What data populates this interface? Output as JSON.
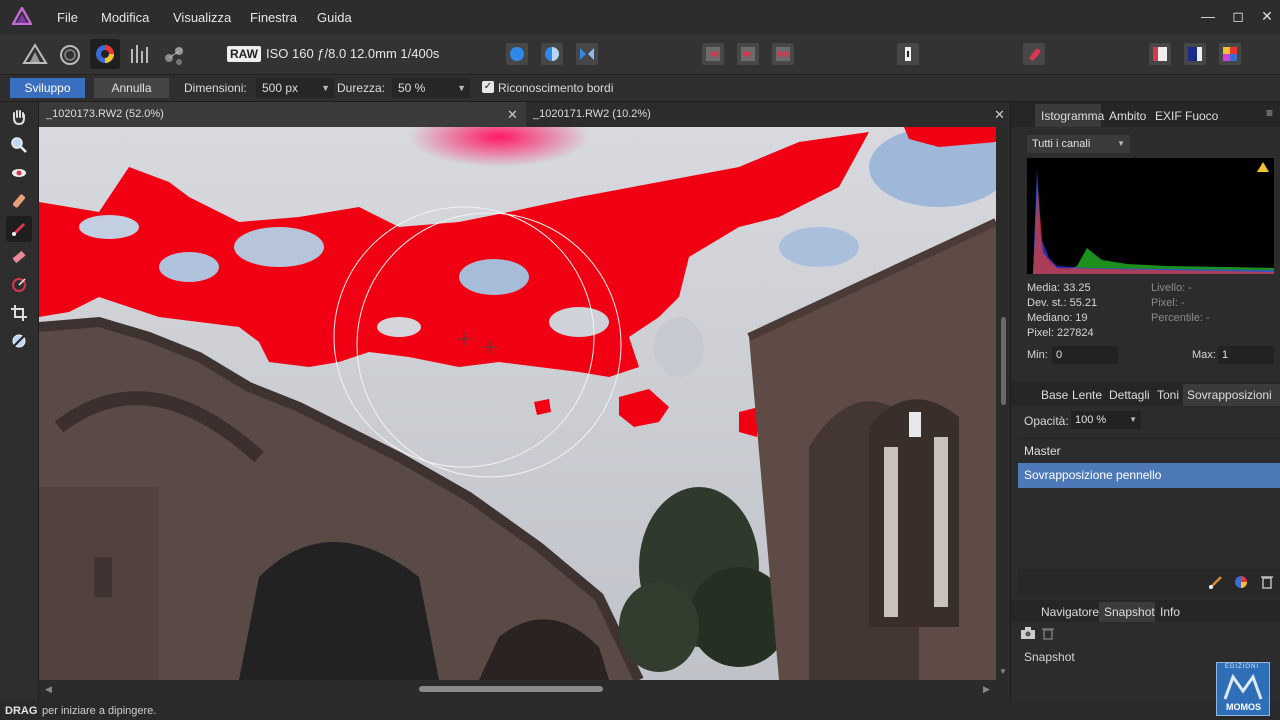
{
  "menubar": {
    "items": [
      "File",
      "Modifica",
      "Visualizza",
      "Finestra",
      "Guida"
    ]
  },
  "toolbar": {
    "raw_badge": "RAW",
    "exif_summary": "ISO 160 ƒ/8.0 12.0mm 1/400s"
  },
  "context": {
    "develop_button": "Sviluppo",
    "cancel_button": "Annulla",
    "size_label": "Dimensioni:",
    "size_value": "500 px",
    "hardness_label": "Durezza:",
    "hardness_value": "50 %",
    "edge_detection_label": "Riconoscimento bordi",
    "edge_detection_checked": true
  },
  "tabs": [
    {
      "label": "_1020173.RW2 (52.0%)"
    },
    {
      "label": "_1020171.RW2 (10.2%)"
    }
  ],
  "status": {
    "key": "DRAG",
    "hint": "per iniziare a dipingere."
  },
  "histogram_panel": {
    "tabs": [
      "Istogramma",
      "Ambito",
      "EXIF",
      "Fuoco"
    ],
    "channel": "Tutti i canali",
    "stats": {
      "media": "Media: 33.25",
      "dev": "Dev. st.: 55.21",
      "mediano": "Mediano: 19",
      "pixel": "Pixel: 227824",
      "livello": "Livello: -",
      "pixel_dim": "Pixel: -",
      "percentile": "Percentile: -"
    },
    "min_label": "Min:",
    "min_value": "0",
    "max_label": "Max:",
    "max_value": "1"
  },
  "adjust_panel": {
    "tabs": [
      "Base",
      "Lente",
      "Dettagli",
      "Toni",
      "Sovrapposizioni"
    ],
    "opacity_label": "Opacità:",
    "opacity_value": "100 %",
    "layers": [
      "Master",
      "Sovrapposizione pennello"
    ]
  },
  "bottom_panel": {
    "tabs": [
      "Navigatore",
      "Snapshot",
      "Info"
    ],
    "section_title": "Snapshot"
  },
  "watermark": {
    "top": "EDIZIONI",
    "bottom": "MOMOS"
  },
  "colors": {
    "accent": "#3a6fc0",
    "overlay_red": "#f00012",
    "selected_row": "#4e79b8"
  },
  "icons": [
    "affinity-logo",
    "persona-photo",
    "persona-liquify",
    "persona-develop",
    "persona-tonemap",
    "persona-export",
    "hand-icon",
    "zoom-icon",
    "red-eye-icon",
    "blemish-icon",
    "brush-icon",
    "eraser-icon",
    "gradient-icon",
    "crop-icon",
    "clipping-icon"
  ]
}
